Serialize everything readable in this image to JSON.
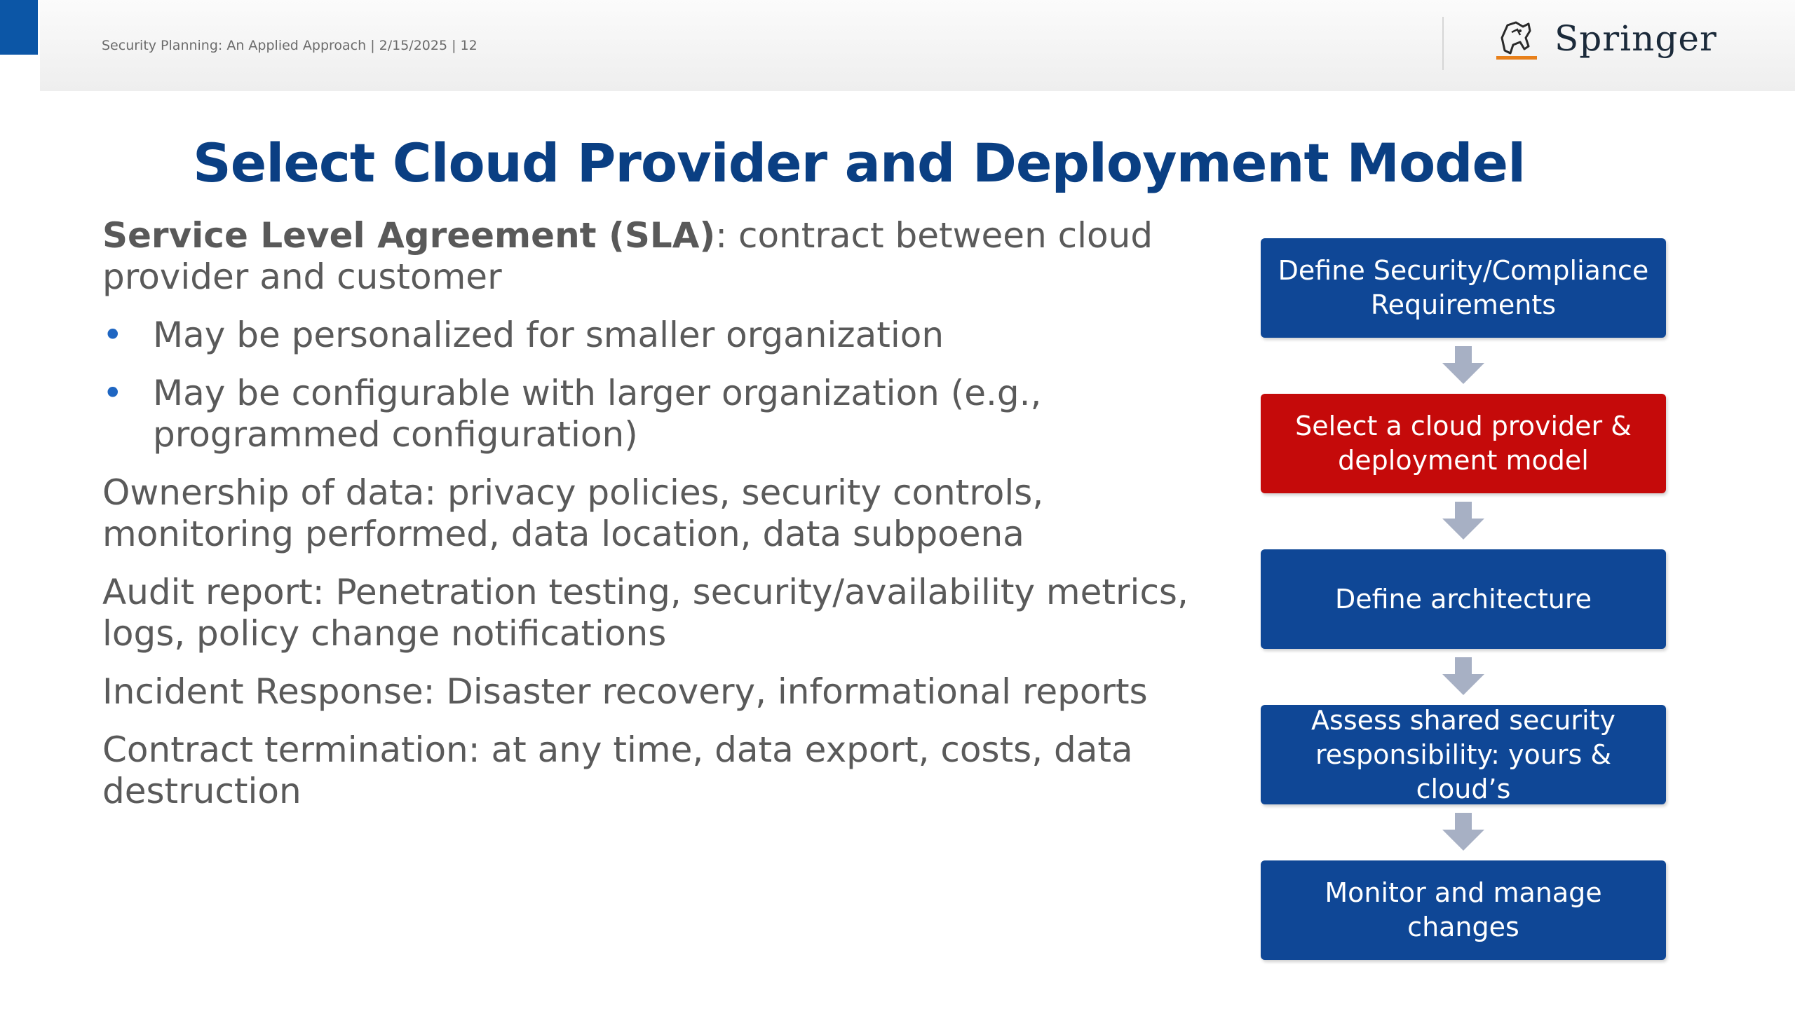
{
  "header": {
    "footer_text": "Security Planning: An Applied Approach | 2/15/2025 | 12",
    "logo_text": "Springer",
    "logo_icon": "springer-horse-icon"
  },
  "title": "Select Cloud Provider and Deployment Model",
  "content": {
    "sla": {
      "term": "Service Level Agreement (SLA)",
      "definition": ": contract between cloud provider and customer",
      "bullets": [
        "May be personalized for smaller organization",
        "May be configurable with larger organization (e.g., programmed configuration)"
      ]
    },
    "paragraphs": [
      "Ownership of data: privacy policies, security controls, monitoring performed,  data location, data subpoena",
      "Audit report:  Penetration testing, security/availability metrics, logs, policy change notifications",
      "Incident Response: Disaster recovery, informational reports",
      "Contract termination: at any time, data export, costs, data destruction"
    ]
  },
  "flow": {
    "steps": [
      {
        "label": "Define Security/Compliance Requirements",
        "color": "#0f4796"
      },
      {
        "label": "Select a cloud provider & deployment model",
        "color": "#c50a0a"
      },
      {
        "label": "Define architecture",
        "color": "#0f4796"
      },
      {
        "label": "Assess shared security responsibility: yours & cloud’s",
        "color": "#0f4796"
      },
      {
        "label": "Monitor and manage changes",
        "color": "#0f4796"
      }
    ],
    "arrow_color": "#a7b0c4",
    "bullet_color": "#1f66c2"
  }
}
